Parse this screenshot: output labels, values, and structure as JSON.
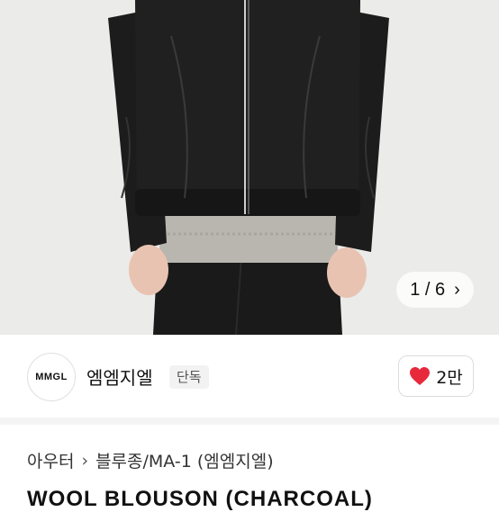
{
  "gallery": {
    "counter": "1 / 6",
    "next_icon": "chevron-right-icon"
  },
  "brand": {
    "logo_text": "MMGL",
    "name": "엠엠지엘",
    "badge": "단독"
  },
  "like": {
    "icon": "heart-icon",
    "count": "2만",
    "color": "#e8283b"
  },
  "breadcrumb": {
    "category": "아우터",
    "subcategory": "블루종/MA-1 (엠엠지엘)",
    "separator_icon": "chevron-right-icon"
  },
  "product": {
    "title": "WOOL BLOUSON (CHARCOAL)"
  }
}
